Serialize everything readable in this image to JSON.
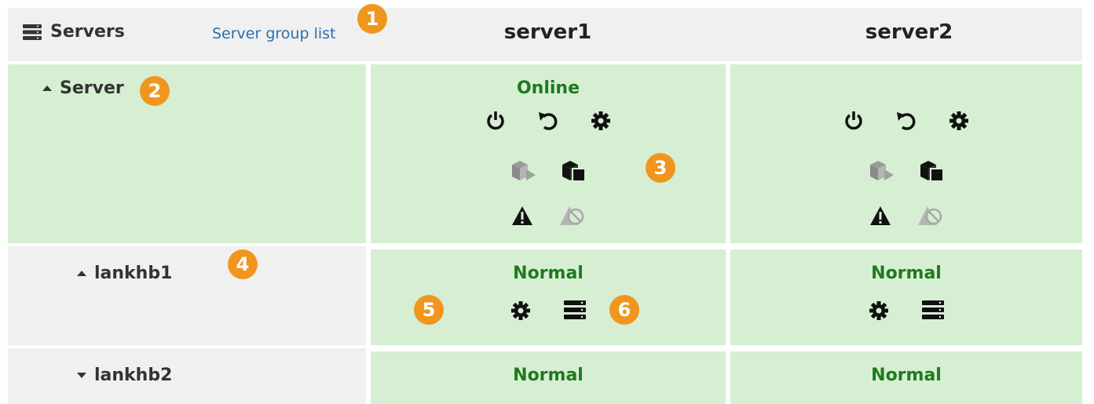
{
  "header": {
    "title": "Servers",
    "server_group_link": "Server group list",
    "columns": [
      "server1",
      "server2"
    ]
  },
  "rows": {
    "server": {
      "label": "Server"
    },
    "lankhb1": {
      "label": "lankhb1"
    },
    "lankhb2": {
      "label": "lankhb2"
    }
  },
  "server1": {
    "server_status": "Online",
    "lankhb1_status": "Normal",
    "lankhb2_status": "Normal"
  },
  "server2": {
    "lankhb1_status": "Normal",
    "lankhb2_status": "Normal"
  },
  "badges": [
    "1",
    "2",
    "3",
    "4",
    "5",
    "6"
  ],
  "colors": {
    "green_cell": "#d6efd3",
    "gray_cell": "#f0f0f0",
    "status_text": "#1e7a1e",
    "link": "#2a6fb0",
    "badge": "#f0961e"
  },
  "icons": [
    "servers-icon",
    "power-icon",
    "restart-icon",
    "gear-icon",
    "cube-start-icon",
    "cube-stop-icon",
    "warning-icon",
    "warning-suppress-icon",
    "list-icon"
  ]
}
